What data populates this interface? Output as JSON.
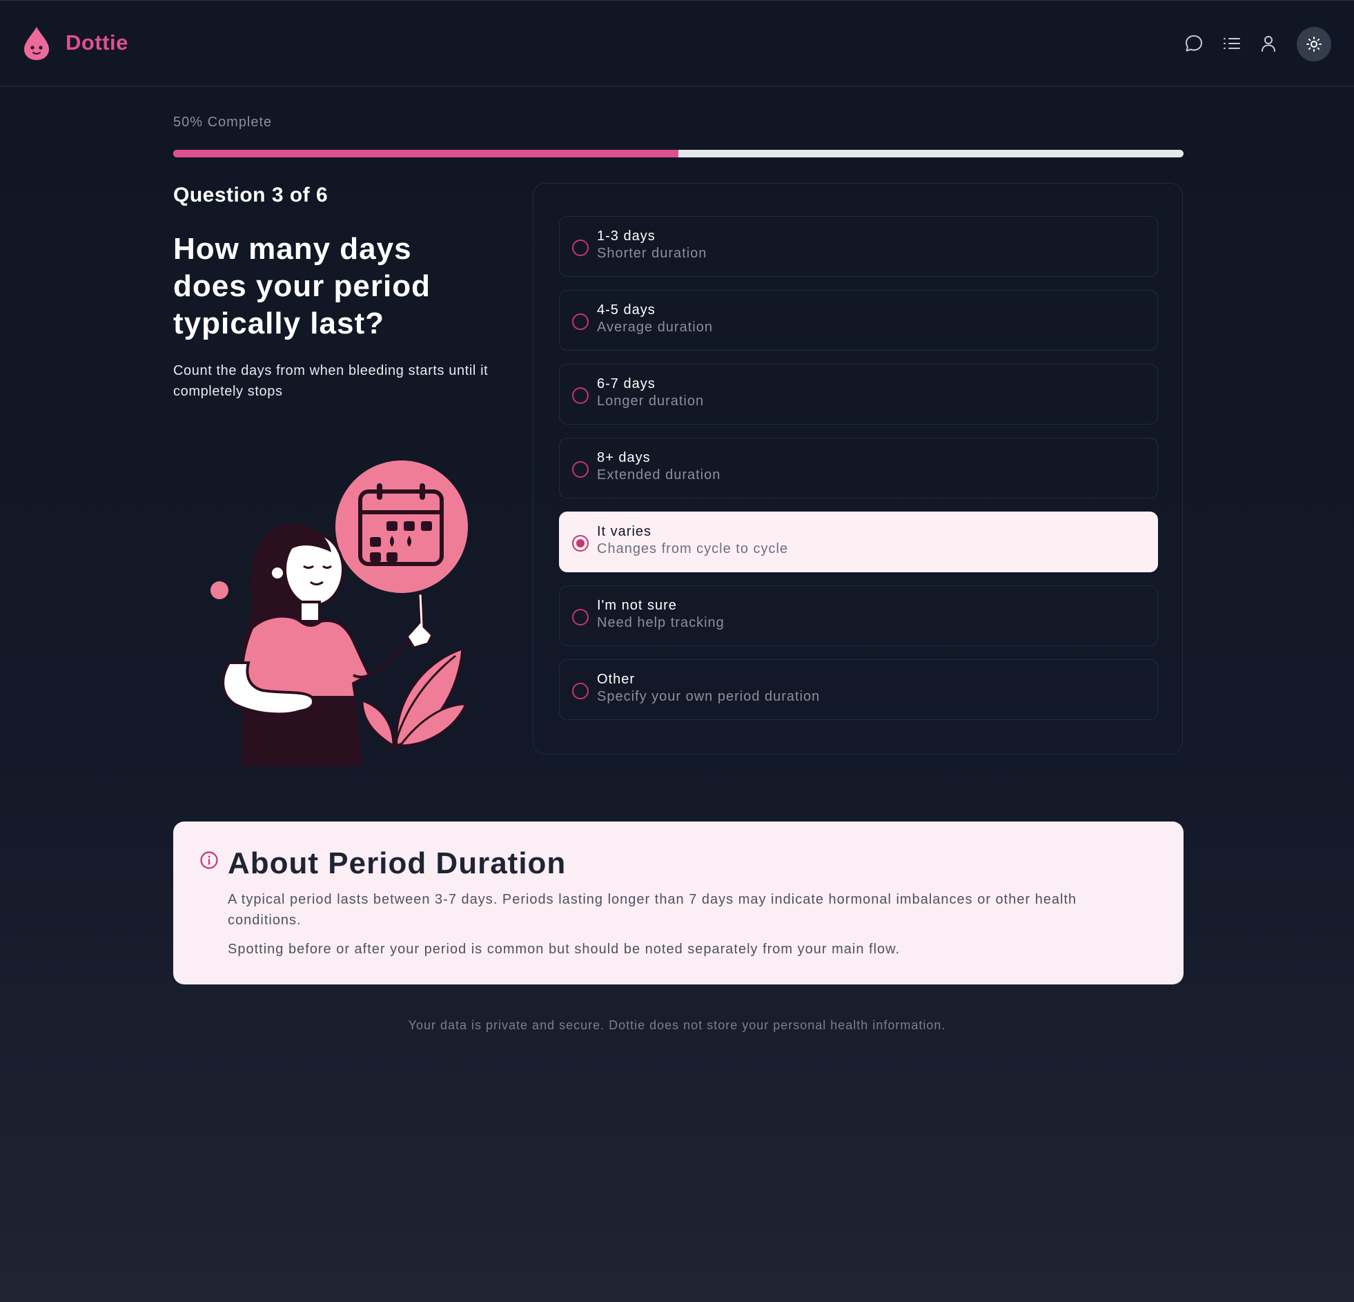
{
  "app": {
    "brand": "Dottie"
  },
  "header": {
    "icons": [
      "chat-icon",
      "list-icon",
      "user-icon",
      "sun-icon"
    ]
  },
  "progress": {
    "label": "50% Complete",
    "percent": 50
  },
  "question": {
    "counter": "Question 3 of 6",
    "title": "How many days does your period typically last?",
    "hint": "Count the days from when bleeding starts until it completely stops"
  },
  "options": [
    {
      "label": "1-3 days",
      "desc": "Shorter duration",
      "selected": false
    },
    {
      "label": "4-5 days",
      "desc": "Average duration",
      "selected": false
    },
    {
      "label": "6-7 days",
      "desc": "Longer duration",
      "selected": false
    },
    {
      "label": "8+ days",
      "desc": "Extended duration",
      "selected": false
    },
    {
      "label": "It varies",
      "desc": "Changes from cycle to cycle",
      "selected": true
    },
    {
      "label": "I'm not sure",
      "desc": "Need help tracking",
      "selected": false
    },
    {
      "label": "Other",
      "desc": "Specify your own period duration",
      "selected": false
    }
  ],
  "info": {
    "title": "About Period Duration",
    "p1": "A typical period lasts between 3-7 days. Periods lasting longer than 7 days may indicate hormonal imbalances or other health conditions.",
    "p2": "Spotting before or after your period is common but should be noted separately from your main flow."
  },
  "footer": {
    "note": "Your data is private and secure. Dottie does not store your personal health information."
  },
  "colors": {
    "accent": "#e0508e",
    "background": "#111624",
    "selected_bg": "#fcf0f5",
    "info_bg": "#fbeff5"
  }
}
